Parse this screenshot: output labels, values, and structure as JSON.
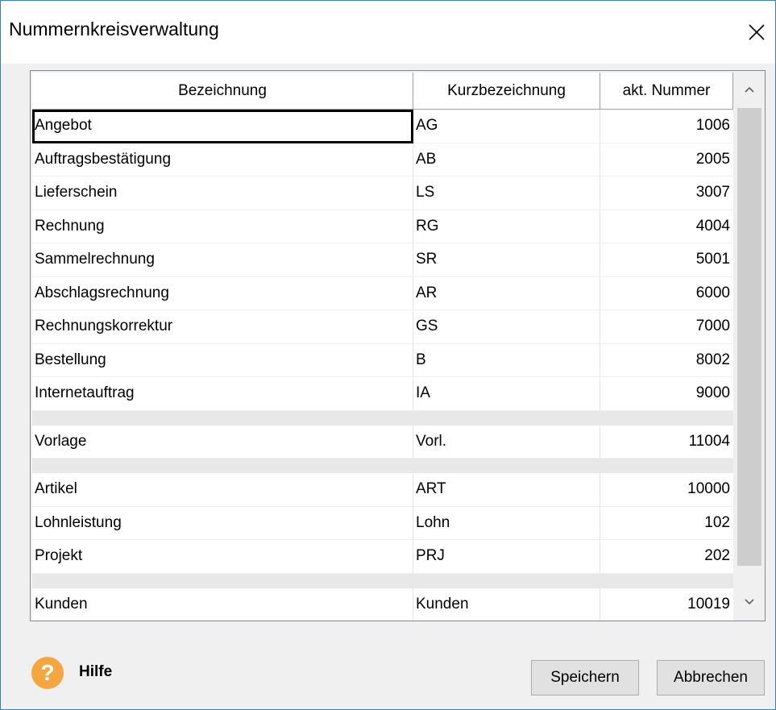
{
  "window": {
    "title": "Nummernkreisverwaltung"
  },
  "table": {
    "columns": [
      "Bezeichnung",
      "Kurzbezeichnung",
      "akt. Nummer"
    ],
    "rows_group1": [
      {
        "name": "Angebot",
        "short": "AG",
        "number": "1006"
      },
      {
        "name": "Auftragsbestätigung",
        "short": "AB",
        "number": "2005"
      },
      {
        "name": "Lieferschein",
        "short": "LS",
        "number": "3007"
      },
      {
        "name": "Rechnung",
        "short": "RG",
        "number": "4004"
      },
      {
        "name": "Sammelrechnung",
        "short": "SR",
        "number": "5001"
      },
      {
        "name": "Abschlagsrechnung",
        "short": "AR",
        "number": "6000"
      },
      {
        "name": "Rechnungskorrektur",
        "short": "GS",
        "number": "7000"
      },
      {
        "name": "Bestellung",
        "short": "B",
        "number": "8002"
      },
      {
        "name": "Internetauftrag",
        "short": "IA",
        "number": "9000"
      }
    ],
    "rows_group2": [
      {
        "name": "Vorlage",
        "short": "Vorl.",
        "number": "11004"
      }
    ],
    "rows_group3": [
      {
        "name": "Artikel",
        "short": "ART",
        "number": "10000"
      },
      {
        "name": "Lohnleistung",
        "short": "Lohn",
        "number": "102"
      },
      {
        "name": "Projekt",
        "short": "PRJ",
        "number": "202"
      }
    ],
    "rows_group4": [
      {
        "name": "Kunden",
        "short": "Kunden",
        "number": "10019"
      }
    ]
  },
  "footer": {
    "help_icon_glyph": "?",
    "help_label": "Hilfe",
    "save_label": "Speichern",
    "cancel_label": "Abbrechen"
  },
  "colors": {
    "help_icon": "#f4a640",
    "border": "#3c7fb1"
  }
}
